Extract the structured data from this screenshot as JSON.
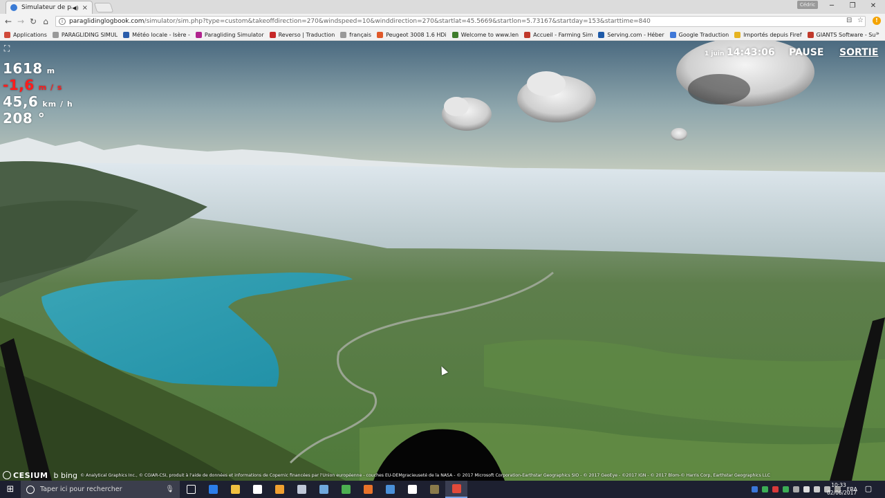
{
  "browser": {
    "tab_title": "Simulateur de parapente",
    "tab_close": "×",
    "tab_mute": "◀)",
    "user_badge": "Cédric",
    "win_minimize": "─",
    "win_maximize": "❐",
    "win_close": "✕",
    "url_host": "paraglidinglogbook.com",
    "url_path": "/simulator/sim.php?type=custom&takeoffdirection=270&windspeed=10&winddirection=270&startlat=45.5669&startlon=5.73167&startday=153&starttime=840",
    "alert_badge": "!",
    "bookmarks_more": "»",
    "bookmarks": [
      {
        "label": "Applications",
        "color": "#d04a3a"
      },
      {
        "label": "PARAGLIDING SIMUL",
        "color": "#999999"
      },
      {
        "label": "Météo locale - Isère -",
        "color": "#2a5caa"
      },
      {
        "label": "Paragliding Simulator",
        "color": "#b0238d"
      },
      {
        "label": "Reverso | Traduction",
        "color": "#c62828"
      },
      {
        "label": "français",
        "color": "#999999"
      },
      {
        "label": "Peugeot 3008 1.6 HDi",
        "color": "#e0592a"
      },
      {
        "label": "Welcome to www.len",
        "color": "#3f7d2d"
      },
      {
        "label": "Accueil - Farming Sim",
        "color": "#c0392b"
      },
      {
        "label": "Serving.com - Héber",
        "color": "#1e5aa8"
      },
      {
        "label": "Google Traduction",
        "color": "#3f78d8"
      },
      {
        "label": "Importés depuis Firef",
        "color": "#e6b422"
      },
      {
        "label": "GIANTS Software - Su",
        "color": "#c0392b"
      }
    ]
  },
  "hud": {
    "altitude": "1618",
    "altitude_unit": "m",
    "vario": "-1,6",
    "vario_unit": "m / s",
    "speed": "45,6",
    "speed_unit": "km / h",
    "heading": "208 °"
  },
  "sim": {
    "date": "1 juin",
    "time": "14:43:06",
    "pause_label": "PAUSE",
    "exit_label": "SORTIE"
  },
  "credits": {
    "cesium": "CESIUM",
    "bing": "b bing",
    "attribution": "© Analytical Graphics Inc., © CGIAR-CSI, produit à l'aide de données et informations de Copernic financées par l'Union européenne - couches EU-DEMgracieuseté de la NASA - © 2017 Microsoft Corporation-Earthstar Geographics SIO - © 2017 GeoEye - ©2017 IGN - © 2017 Blom-© Harris Corp, Earthstar Geographics LLC"
  },
  "taskbar": {
    "search_placeholder": "Taper ici pour rechercher",
    "tray_lang": "FRA",
    "clock_time": "10:33",
    "clock_date": "02/06/2017",
    "apps": [
      {
        "name": "task-view-icon",
        "color": "#ffffff"
      },
      {
        "name": "edge-icon",
        "color": "#2b7de9"
      },
      {
        "name": "file-explorer-icon",
        "color": "#f0c040"
      },
      {
        "name": "store-icon",
        "color": "#ffffff"
      },
      {
        "name": "media-player-icon",
        "color": "#f0a030"
      },
      {
        "name": "app-icon-6",
        "color": "#c0c8d8"
      },
      {
        "name": "app-icon-7",
        "color": "#6fa8dc"
      },
      {
        "name": "app-icon-8",
        "color": "#4caf50"
      },
      {
        "name": "firefox-icon",
        "color": "#e8732a"
      },
      {
        "name": "app-icon-10",
        "color": "#4a90d9"
      },
      {
        "name": "mail-icon",
        "color": "#ffffff"
      },
      {
        "name": "app-icon-12",
        "color": "#8a7a4a"
      },
      {
        "name": "chrome-icon",
        "color": "#e24a3a"
      }
    ]
  }
}
